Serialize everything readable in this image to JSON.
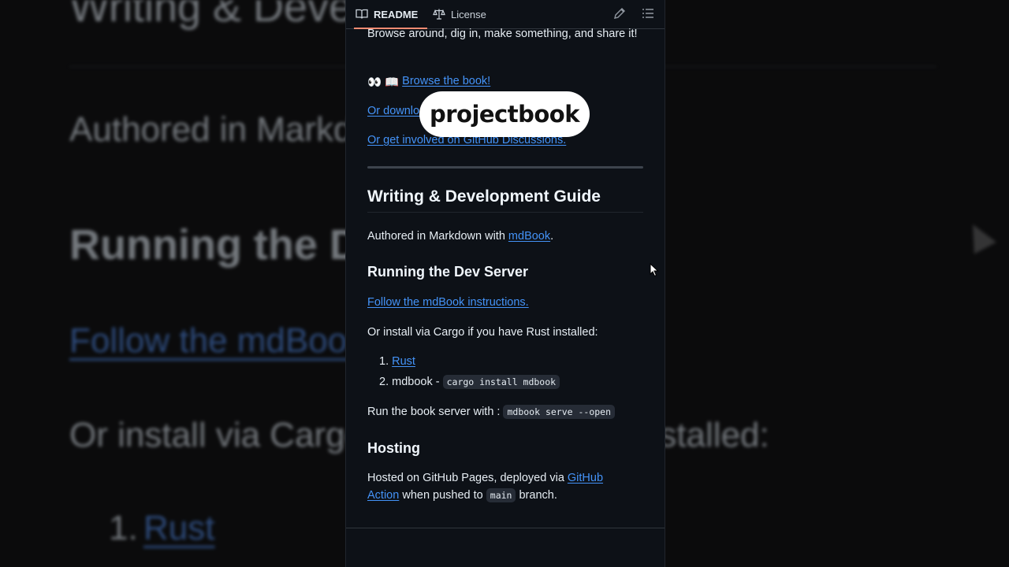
{
  "background": {
    "line1": "Writing & Development Guide",
    "line2": "Authored in Markdown with mdBook.",
    "line3": "Running the Dev Server",
    "line4": "Follow the mdBook instructions.",
    "line5": "Or install via Cargo if you have Rust installed:",
    "line6_num": "1.",
    "line6_link": "Rust"
  },
  "tabs": {
    "readme": "README",
    "license": "License"
  },
  "readme": {
    "intro": "Browse around, dig in, make something, and share it!",
    "browse_emoji": "👀 📖",
    "browse_link": "Browse the book!",
    "download_link": "Or download",
    "discussions_link": "Or get involved on GitHub Discussions.",
    "guide_heading": "Writing & Development Guide",
    "authored_prefix": "Authored in Markdown with ",
    "authored_link": "mdBook",
    "authored_suffix": ".",
    "dev_server_heading": "Running the Dev Server",
    "follow_link": "Follow the mdBook instructions.",
    "cargo_text": "Or install via Cargo if you have Rust installed:",
    "list": [
      {
        "num": "1.",
        "link": "Rust"
      },
      {
        "num": "2.",
        "text": "mdbook - ",
        "code": "cargo install mdbook"
      }
    ],
    "run_prefix": "Run the book server with : ",
    "run_code": "mdbook serve --open",
    "hosting_heading": "Hosting",
    "hosted_prefix": "Hosted on GitHub Pages, deployed via ",
    "hosted_link1": "GitHub",
    "hosted_link2": "Action",
    "hosted_mid": " when pushed to ",
    "hosted_code": "main",
    "hosted_suffix": " branch."
  },
  "overlay": {
    "label": "projectbook"
  },
  "colors": {
    "panel_bg": "#0d1117",
    "link": "#4493f8",
    "tab_underline": "#fd8c73"
  },
  "icons": [
    "book-icon",
    "scale-icon",
    "pencil-icon",
    "list-icon",
    "cursor-icon"
  ]
}
